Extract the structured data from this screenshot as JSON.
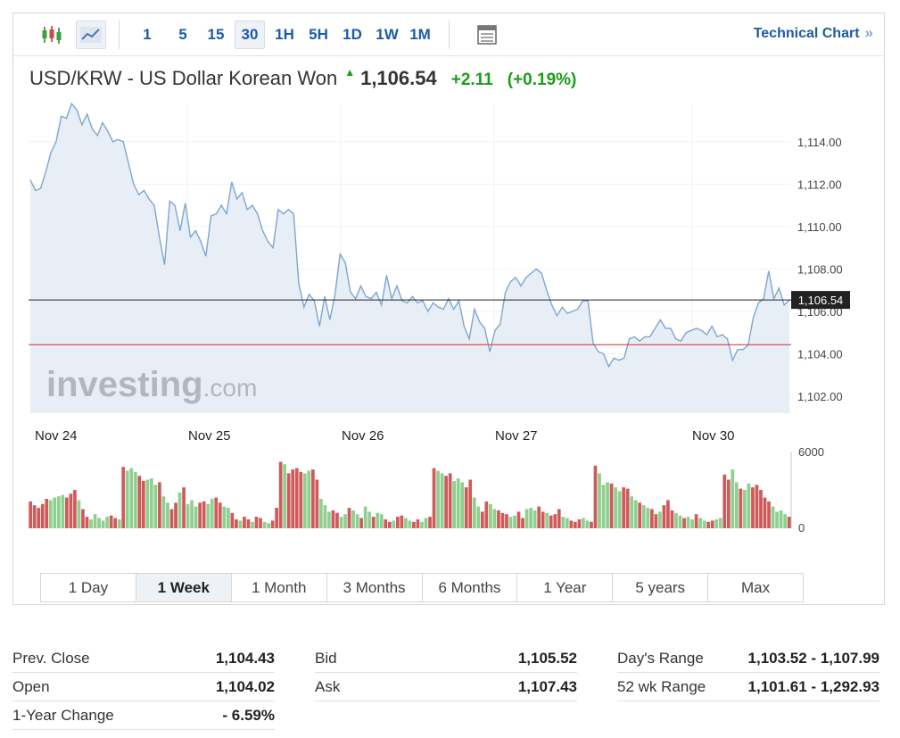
{
  "toolbar": {
    "candles_icon": "candlestick-icon",
    "line_icon": "line-chart-icon",
    "intervals": [
      "1",
      "5",
      "15",
      "30",
      "1H",
      "5H",
      "1D",
      "1W",
      "1M"
    ],
    "active_interval": "30",
    "table_icon": "table-icon",
    "technical_link": "Technical Chart",
    "technical_arrow": "»"
  },
  "header": {
    "name": "USD/KRW - US Dollar Korean Won",
    "price": "1,106.54",
    "change": "+2.11",
    "change_pct": "(+0.19%)",
    "direction_icon": "arrow-up-icon"
  },
  "colors": {
    "line": "#7ea6cf",
    "area": "#e7eef5",
    "up_bar": "#8fcf8f",
    "down_bar": "#cf5a5a",
    "last_price_line": "#222222",
    "prev_close_line": "#cc3333",
    "accent": "#1d5aa8",
    "positive": "#1a9d1a"
  },
  "chart_data": {
    "type": "area",
    "title": "USD/KRW - US Dollar Korean Won",
    "x_labels": [
      "Nov 24",
      "Nov 25",
      "Nov 26",
      "Nov 27",
      "Nov 30"
    ],
    "ylim": [
      1101.2,
      1115.8
    ],
    "yticks": [
      1102,
      1104,
      1106,
      1108,
      1110,
      1112,
      1114
    ],
    "ytick_labels": [
      "1,102.00",
      "1,104.00",
      "1,106.00",
      "1,108.00",
      "1,110.00",
      "1,112.00",
      "1,114.00"
    ],
    "last_price": 1106.54,
    "last_price_label": "1,106.54",
    "prev_close": 1104.43,
    "watermark": "investing.com",
    "series": [
      {
        "values": [
          1112.2,
          1111.7,
          1111.8,
          1112.6,
          1113.5,
          1114.0,
          1115.2,
          1115.1,
          1115.8,
          1115.5,
          1114.8,
          1115.3,
          1114.6,
          1114.3,
          1114.9,
          1114.5,
          1114.0,
          1114.1,
          1114.0,
          1113.0,
          1112.0,
          1111.5,
          1111.7,
          1111.3,
          1111.0,
          1109.5,
          1108.2,
          1111.2,
          1111.0,
          1109.8,
          1111.1,
          1109.5,
          1109.8,
          1109.3,
          1108.6,
          1110.5,
          1110.6,
          1111.0,
          1110.6,
          1112.1,
          1111.3,
          1111.6,
          1110.8,
          1111.0,
          1110.6,
          1109.8,
          1109.3,
          1109.0,
          1110.8,
          1110.6,
          1110.8,
          1110.6,
          1107.3,
          1106.2,
          1106.8,
          1106.5,
          1105.3,
          1106.7,
          1105.6,
          1106.8,
          1108.7,
          1108.3,
          1106.9,
          1106.6,
          1107.2,
          1106.7,
          1106.6,
          1106.9,
          1106.3,
          1107.7,
          1106.6,
          1107.2,
          1106.5,
          1106.4,
          1106.7,
          1106.4,
          1106.5,
          1106.0,
          1106.4,
          1106.2,
          1106.1,
          1106.6,
          1106.1,
          1106.5,
          1105.3,
          1104.7,
          1106.1,
          1105.5,
          1105.2,
          1104.1,
          1105.1,
          1105.4,
          1106.9,
          1107.4,
          1107.6,
          1107.2,
          1107.6,
          1107.8,
          1108.0,
          1107.8,
          1107.0,
          1106.3,
          1105.8,
          1106.2,
          1105.9,
          1106.0,
          1106.1,
          1106.5,
          1106.5,
          1104.5,
          1104.1,
          1104.0,
          1103.4,
          1103.8,
          1103.7,
          1103.8,
          1104.7,
          1104.8,
          1104.6,
          1104.8,
          1104.8,
          1105.2,
          1105.6,
          1105.2,
          1105.2,
          1104.7,
          1104.6,
          1105.0,
          1105.1,
          1105.2,
          1105.1,
          1104.9,
          1105.3,
          1104.8,
          1104.9,
          1104.7,
          1103.7,
          1104.2,
          1104.2,
          1104.4,
          1105.7,
          1106.4,
          1106.6,
          1107.9,
          1106.6,
          1107.1,
          1106.3,
          1106.54
        ]
      }
    ],
    "volume": {
      "ylim": [
        0,
        6000
      ],
      "ytick_labels": [
        "0",
        "6000"
      ],
      "values": [
        2100,
        1800,
        1600,
        1900,
        2300,
        2200,
        2400,
        2500,
        2600,
        2400,
        2700,
        3000,
        2200,
        1500,
        900,
        700,
        1100,
        800,
        600,
        900,
        1000,
        800,
        700,
        4800,
        4500,
        4700,
        4400,
        4100,
        3700,
        3800,
        3900,
        3400,
        3600,
        2500,
        2000,
        1500,
        2000,
        2800,
        3200,
        1900,
        2200,
        1700,
        2000,
        2100,
        1900,
        2300,
        2400,
        2000,
        1700,
        1600,
        1200,
        700,
        600,
        900,
        700,
        500,
        900,
        800,
        500,
        400,
        600,
        1600,
        5200,
        5000,
        4300,
        4600,
        4700,
        4400,
        4300,
        4500,
        4600,
        3800,
        2300,
        1800,
        1300,
        1400,
        1200,
        900,
        1100,
        1600,
        1400,
        1100,
        800,
        1700,
        1300,
        900,
        1200,
        1100,
        700,
        500,
        600,
        900,
        1000,
        800,
        600,
        500,
        700,
        500,
        800,
        900,
        4700,
        4500,
        4300,
        4100,
        4300,
        3700,
        3900,
        3600,
        3200,
        3800,
        2400,
        1700,
        1300,
        2100,
        1900,
        1500,
        1400,
        1200,
        1100,
        900,
        1000,
        1300,
        800,
        1500,
        1600,
        1400,
        1700,
        1300,
        1200,
        1000,
        1100,
        1500,
        900,
        800,
        600,
        500,
        700,
        800,
        600,
        500,
        4900,
        4300,
        3400,
        3600,
        3500,
        3200,
        2900,
        3200,
        3100,
        2500,
        2200,
        2000,
        1800,
        1600,
        1500,
        1100,
        1300,
        1800,
        2200,
        1400,
        1200,
        1000,
        800,
        900,
        700,
        1100,
        800,
        600,
        500,
        600,
        700,
        800,
        4200,
        3800,
        4600,
        3600,
        3100,
        3000,
        3500,
        3200,
        3400,
        3000,
        2400,
        2100,
        1700,
        1300,
        1400,
        1100,
        900
      ],
      "colors": "ddddduuuudddudduuuuudduduuudduuuduudduduuudduudduudduddudduudddudddduudduuudduuduuduuduuddudduudduudduudduuudduudduuddduudduuudduddduuddduudduuuduudduuduudduddduuduuduudduudduuduu"
    }
  },
  "range_tabs": [
    "1 Day",
    "1 Week",
    "1 Month",
    "3 Months",
    "6 Months",
    "1 Year",
    "5 years",
    "Max"
  ],
  "active_range": "1 Week",
  "stats": {
    "col1": [
      {
        "label": "Prev. Close",
        "value": "1,104.43"
      },
      {
        "label": "Open",
        "value": "1,104.02"
      },
      {
        "label": "1-Year Change",
        "value": "- 6.59%"
      }
    ],
    "col2": [
      {
        "label": "Bid",
        "value": "1,105.52"
      },
      {
        "label": "Ask",
        "value": "1,107.43"
      }
    ],
    "col3": [
      {
        "label": "Day's Range",
        "value": "1,103.52 - 1,107.99"
      },
      {
        "label": "52 wk Range",
        "value": "1,101.61 - 1,292.93"
      }
    ]
  }
}
